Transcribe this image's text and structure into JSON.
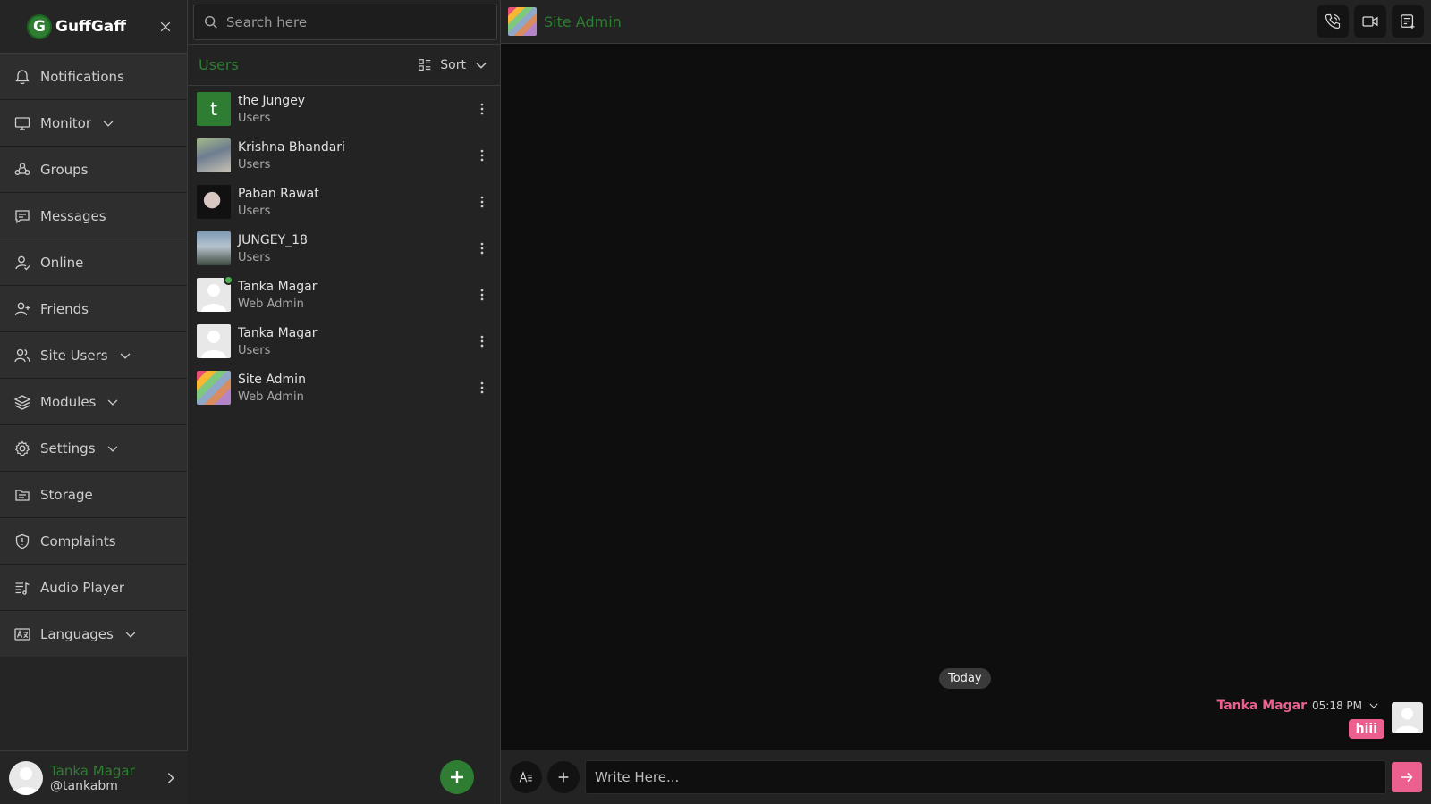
{
  "brand": {
    "name": "GuffGaff",
    "logo_letter": "G"
  },
  "nav": {
    "items": [
      {
        "label": "Notifications",
        "icon": "bell-icon",
        "dropdown": false
      },
      {
        "label": "Monitor",
        "icon": "monitor-icon",
        "dropdown": true
      },
      {
        "label": "Groups",
        "icon": "groups-icon",
        "dropdown": false
      },
      {
        "label": "Messages",
        "icon": "message-icon",
        "dropdown": false
      },
      {
        "label": "Online",
        "icon": "user-check-icon",
        "dropdown": false
      },
      {
        "label": "Friends",
        "icon": "user-plus-icon",
        "dropdown": false
      },
      {
        "label": "Site Users",
        "icon": "users-icon",
        "dropdown": true
      },
      {
        "label": "Modules",
        "icon": "layers-icon",
        "dropdown": true
      },
      {
        "label": "Settings",
        "icon": "gear-icon",
        "dropdown": true
      },
      {
        "label": "Storage",
        "icon": "storage-icon",
        "dropdown": false
      },
      {
        "label": "Complaints",
        "icon": "shield-icon",
        "dropdown": false
      },
      {
        "label": "Audio Player",
        "icon": "playlist-icon",
        "dropdown": false
      },
      {
        "label": "Languages",
        "icon": "language-icon",
        "dropdown": true
      }
    ],
    "footer": {
      "name": "Tanka Magar",
      "handle": "@tankabm"
    }
  },
  "users_panel": {
    "search_placeholder": "Search here",
    "title": "Users",
    "sort_label": "Sort",
    "users": [
      {
        "name": "the Jungey",
        "role": "Users",
        "initial": "t",
        "avatar": "letter",
        "online": false
      },
      {
        "name": "Krishna Bhandari",
        "role": "Users",
        "initial": "",
        "avatar": "photo1",
        "online": false
      },
      {
        "name": "Paban Rawat",
        "role": "Users",
        "initial": "",
        "avatar": "photo2",
        "online": false
      },
      {
        "name": "JUNGEY_18",
        "role": "Users",
        "initial": "",
        "avatar": "photo3",
        "online": false
      },
      {
        "name": "Tanka Magar",
        "role": "Web Admin",
        "initial": "",
        "avatar": "default",
        "online": true
      },
      {
        "name": "Tanka Magar",
        "role": "Users",
        "initial": "",
        "avatar": "default",
        "online": false
      },
      {
        "name": "Site Admin",
        "role": "Web Admin",
        "initial": "",
        "avatar": "stripes",
        "online": false
      }
    ]
  },
  "chat": {
    "title": "Site Admin",
    "day_label": "Today",
    "message": {
      "sender": "Tanka Magar",
      "time": "05:18 PM",
      "text": "hiii"
    },
    "composer_placeholder": "Write Here..."
  },
  "colors": {
    "accent_green": "#2e7d32",
    "accent_pink": "#ec6090",
    "online": "#4caf50"
  }
}
